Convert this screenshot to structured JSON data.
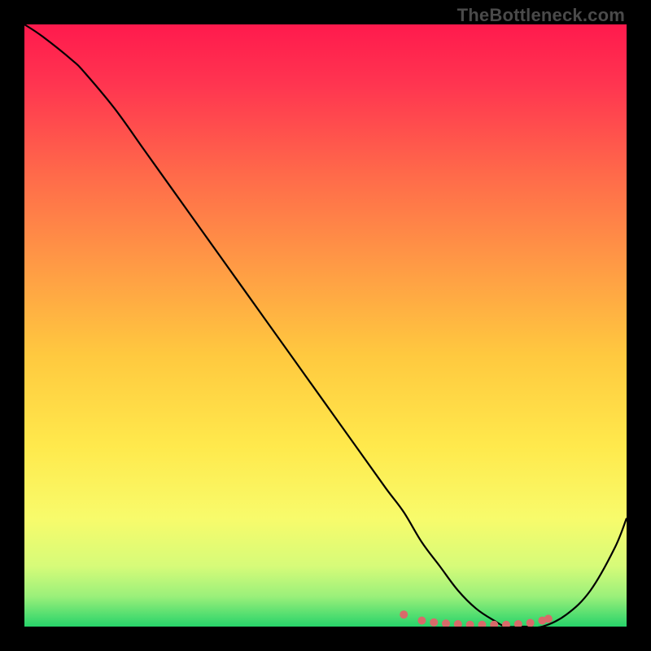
{
  "watermark": "TheBottleneck.com",
  "chart_data": {
    "type": "line",
    "title": "",
    "xlabel": "",
    "ylabel": "",
    "xlim": [
      0,
      100
    ],
    "ylim": [
      0,
      100
    ],
    "grid": false,
    "gradient_stops": [
      {
        "pos": 0.0,
        "color": "#ff1a4d"
      },
      {
        "pos": 0.1,
        "color": "#ff3550"
      },
      {
        "pos": 0.25,
        "color": "#ff6a4a"
      },
      {
        "pos": 0.4,
        "color": "#ff9a45"
      },
      {
        "pos": 0.55,
        "color": "#ffc93f"
      },
      {
        "pos": 0.7,
        "color": "#ffe94c"
      },
      {
        "pos": 0.82,
        "color": "#f8fb6b"
      },
      {
        "pos": 0.9,
        "color": "#d6fb79"
      },
      {
        "pos": 0.95,
        "color": "#9af07a"
      },
      {
        "pos": 1.0,
        "color": "#27d36a"
      }
    ],
    "series": [
      {
        "name": "bottleneck-curve",
        "color": "#000000",
        "x": [
          0,
          3,
          8,
          10,
          15,
          20,
          25,
          30,
          35,
          40,
          45,
          50,
          55,
          60,
          63,
          66,
          69,
          72,
          75,
          78,
          80,
          83,
          86,
          90,
          94,
          98,
          100
        ],
        "y": [
          100,
          98,
          94,
          92,
          86,
          79,
          72,
          65,
          58,
          51,
          44,
          37,
          30,
          23,
          19,
          14,
          10,
          6,
          3,
          1,
          0,
          0,
          0,
          2,
          6,
          13,
          18
        ]
      },
      {
        "name": "optimal-markers",
        "type": "scatter",
        "color": "#d86a6a",
        "x": [
          63,
          66,
          68,
          70,
          72,
          74,
          76,
          78,
          80,
          82,
          84,
          86,
          87
        ],
        "y": [
          2,
          1,
          0.7,
          0.5,
          0.4,
          0.3,
          0.3,
          0.3,
          0.3,
          0.4,
          0.6,
          1,
          1.3
        ]
      }
    ]
  }
}
